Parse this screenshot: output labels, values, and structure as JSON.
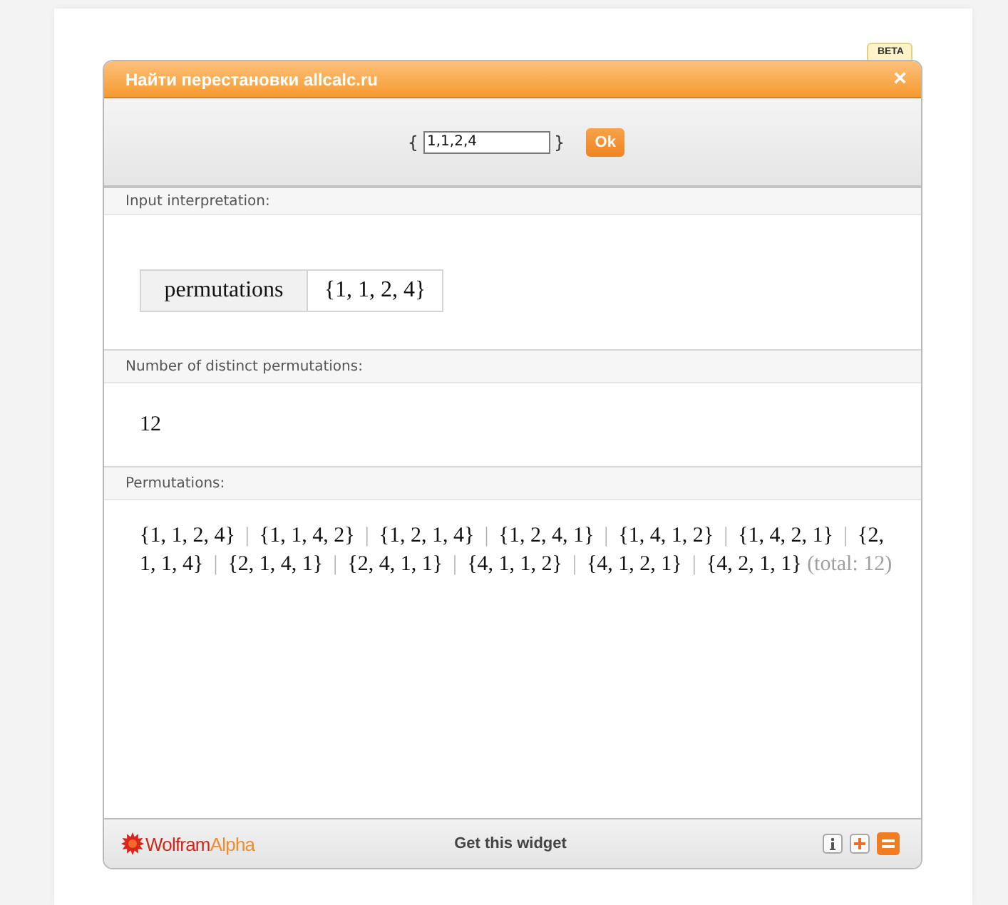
{
  "badge": "BETA",
  "window": {
    "title": "Найти перестановки allcalc.ru",
    "close": "×"
  },
  "input": {
    "open_brace": "{",
    "value": "1,1,2,4",
    "close_brace": "}",
    "button": "Ok"
  },
  "pods": [
    {
      "kind": "table",
      "title": "Input interpretation:",
      "label": "permutations",
      "value": "{1, 1, 2, 4}"
    },
    {
      "kind": "number",
      "title": "Number of distinct permutations:",
      "value": "12"
    },
    {
      "kind": "list",
      "title": "Permutations:",
      "items": [
        {
          "value": "{1, 1, 2, 4}",
          "separator": "|"
        },
        {
          "value": "{1, 1, 4, 2}",
          "separator": "|"
        },
        {
          "value": "{1, 2, 1, 4}",
          "separator": "|"
        },
        {
          "value": "{1, 2, 4, 1}",
          "separator": "|"
        },
        {
          "value": "{1, 4, 1, 2}",
          "separator": "|"
        },
        {
          "value": "{1, 4, 2, 1}",
          "separator": "|"
        },
        {
          "value": "{2, 1, 1, 4}",
          "separator": "|"
        },
        {
          "value": "{2, 1, 4, 1}",
          "separator": "|"
        },
        {
          "value": "{2, 4, 1, 1}",
          "separator": "|"
        },
        {
          "value": "{4, 1, 1, 2}",
          "separator": "|"
        },
        {
          "value": "{4, 1, 2, 1}",
          "separator": "|"
        },
        {
          "value": "{4, 2, 1, 1}"
        }
      ],
      "total": "(total: 12)"
    }
  ],
  "footer": {
    "logo": {
      "name": "Wolfram",
      "suffix": "Alpha"
    },
    "link": "Get this widget"
  }
}
